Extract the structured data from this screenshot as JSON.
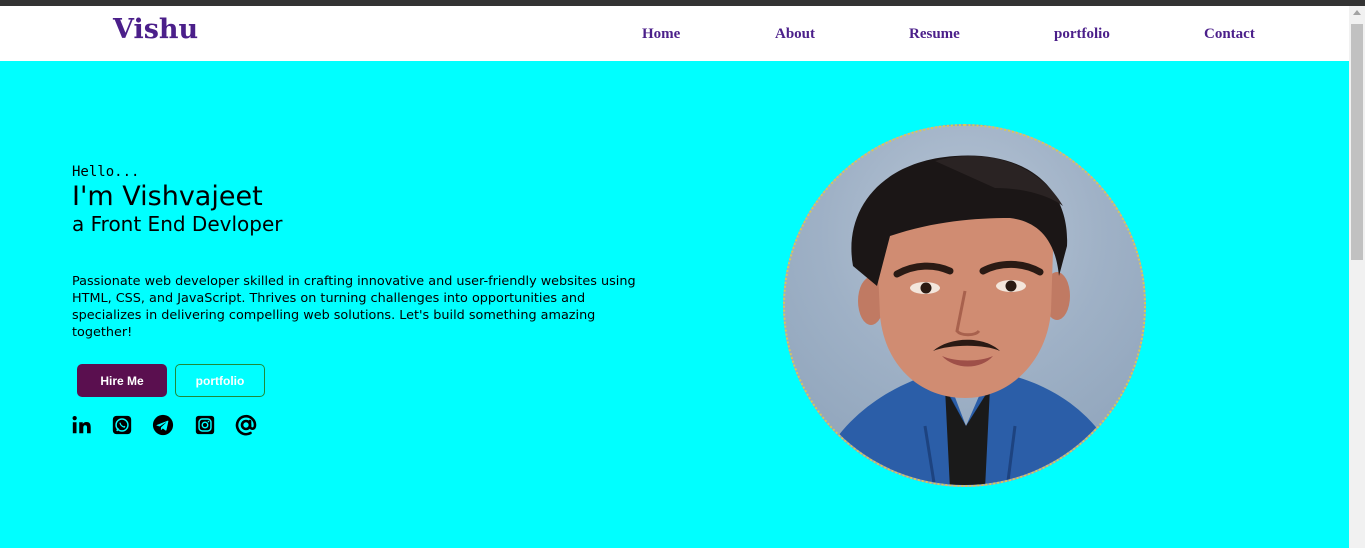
{
  "brand": "Vishu",
  "nav": {
    "home": "Home",
    "about": "About",
    "resume": "Resume",
    "portfolio": "portfolio",
    "contact": "Contact"
  },
  "hero": {
    "greeting": "Hello...",
    "name": "I'm Vishvajeet",
    "role": "a Front End Devloper",
    "bio": "Passionate web developer skilled in crafting innovative and user-friendly websites using HTML, CSS, and JavaScript. Thrives on turning challenges into opportunities and specializes in delivering compelling web solutions. Let's build something amazing together!"
  },
  "buttons": {
    "hire": "Hire Me",
    "portfolio": "portfolio"
  },
  "social_icons": [
    "linkedin-icon",
    "whatsapp-icon",
    "telegram-icon",
    "instagram-icon",
    "email-at-icon"
  ],
  "colors": {
    "page_background": "#00ffff",
    "brand_purple": "#4b1f8a",
    "hire_button": "#5a0f4f",
    "portfolio_border": "#1f8a3a"
  }
}
